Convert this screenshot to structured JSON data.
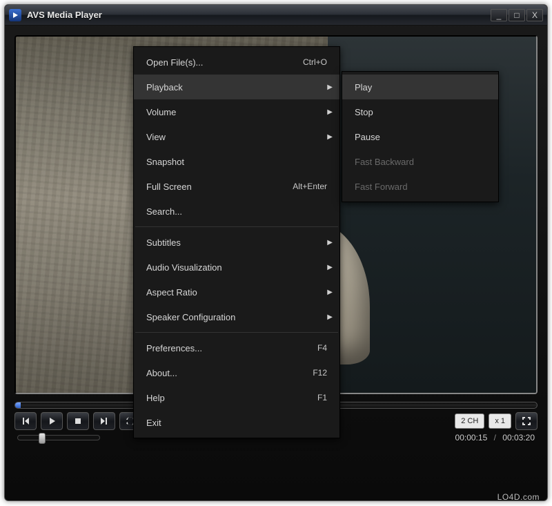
{
  "app": {
    "title": "AVS Media Player"
  },
  "window_buttons": {
    "minimize": "_",
    "maximize": "□",
    "close": "X"
  },
  "controls": {
    "channel_label": "2 CH",
    "speed_label": "x 1"
  },
  "time": {
    "current": "00:00:15",
    "total": "00:03:20",
    "separator": "/"
  },
  "watermark": "LO4D.com",
  "menu": {
    "open": "Open File(s)...",
    "open_accel": "Ctrl+O",
    "playback": "Playback",
    "volume": "Volume",
    "view": "View",
    "snapshot": "Snapshot",
    "fullscreen": "Full Screen",
    "fullscreen_accel": "Alt+Enter",
    "search": "Search...",
    "subtitles": "Subtitles",
    "audiovis": "Audio Visualization",
    "aspect": "Aspect Ratio",
    "speaker": "Speaker Configuration",
    "prefs": "Preferences...",
    "prefs_accel": "F4",
    "about": "About...",
    "about_accel": "F12",
    "help": "Help",
    "help_accel": "F1",
    "exit": "Exit"
  },
  "submenu": {
    "play": "Play",
    "stop": "Stop",
    "pause": "Pause",
    "fast_backward": "Fast Backward",
    "fast_forward": "Fast Forward"
  }
}
